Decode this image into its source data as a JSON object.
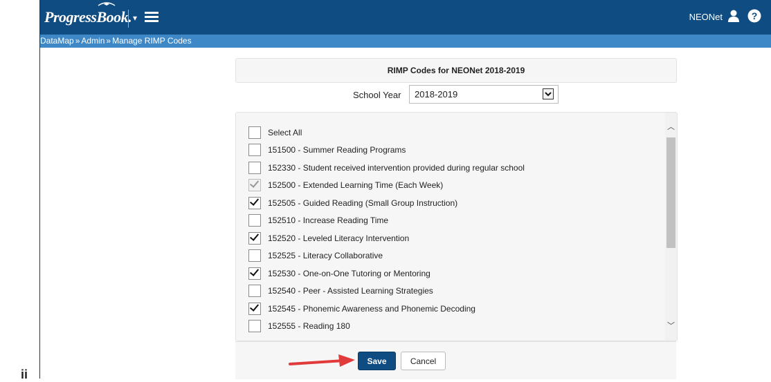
{
  "gutter": {
    "text": "ii"
  },
  "header": {
    "logo_text": "ProgressBook.",
    "user_label": "NEONet",
    "icons": {
      "menu": "hamburger-menu-icon",
      "user": "user-icon",
      "help": "help-icon"
    },
    "colors": {
      "topbar": "#0f4c81",
      "breadcrumb_bar": "#3f88c7"
    }
  },
  "breadcrumb": {
    "items": [
      "DataMap",
      "Admin",
      "Manage RIMP Codes"
    ],
    "separator": "»"
  },
  "page": {
    "title": "RIMP Codes for NEONet 2018-2019",
    "school_year_label": "School Year",
    "school_year_value": "2018-2019"
  },
  "list": {
    "select_all_label": "Select All",
    "items": [
      {
        "label": "151500 - Summer Reading Programs",
        "checked": false,
        "disabled": false
      },
      {
        "label": "152330 - Student received intervention provided during regular school",
        "checked": false,
        "disabled": false
      },
      {
        "label": "152500 - Extended Learning Time (Each Week)",
        "checked": true,
        "disabled": true
      },
      {
        "label": "152505 - Guided Reading (Small Group Instruction)",
        "checked": true,
        "disabled": false
      },
      {
        "label": "152510 - Increase Reading Time",
        "checked": false,
        "disabled": false
      },
      {
        "label": "152520 - Leveled Literacy Intervention",
        "checked": true,
        "disabled": false
      },
      {
        "label": "152525 - Literacy Collaborative",
        "checked": false,
        "disabled": false
      },
      {
        "label": "152530 - One-on-One Tutoring or Mentoring",
        "checked": true,
        "disabled": false
      },
      {
        "label": "152540 - Peer - Assisted Learning Strategies",
        "checked": false,
        "disabled": false
      },
      {
        "label": "152545 - Phonemic Awareness and Phonemic Decoding",
        "checked": true,
        "disabled": false
      },
      {
        "label": "152555 - Reading 180",
        "checked": false,
        "disabled": false
      }
    ]
  },
  "footer": {
    "save_label": "Save",
    "cancel_label": "Cancel",
    "annotation_color": "#e03a3a"
  }
}
